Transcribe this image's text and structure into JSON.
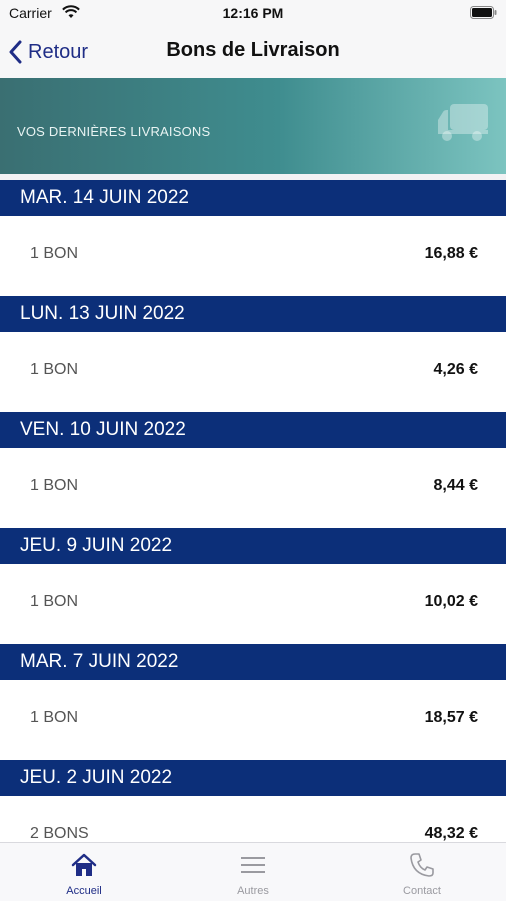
{
  "status_bar": {
    "carrier": "Carrier",
    "time": "12:16 PM"
  },
  "nav": {
    "back_label": "Retour",
    "title": "Bons de Livraison"
  },
  "banner": {
    "text": "VOS DERNIÈRES LIVRAISONS",
    "icon": "truck-icon"
  },
  "deliveries": [
    {
      "date": "MAR. 14 JUIN 2022",
      "count": "1 BON",
      "amount": "16,88 €"
    },
    {
      "date": "LUN. 13 JUIN 2022",
      "count": "1 BON",
      "amount": "4,26 €"
    },
    {
      "date": "VEN. 10 JUIN 2022",
      "count": "1 BON",
      "amount": "8,44 €"
    },
    {
      "date": "JEU. 9 JUIN 2022",
      "count": "1 BON",
      "amount": "10,02 €"
    },
    {
      "date": "MAR. 7 JUIN 2022",
      "count": "1 BON",
      "amount": "18,57 €"
    },
    {
      "date": "JEU. 2 JUIN 2022",
      "count": "2 BONS",
      "amount": "48,32 €"
    }
  ],
  "tabs": [
    {
      "label": "Accueil",
      "icon": "home-icon",
      "active": true
    },
    {
      "label": "Autres",
      "icon": "menu-icon",
      "active": false
    },
    {
      "label": "Contact",
      "icon": "phone-icon",
      "active": false
    }
  ],
  "colors": {
    "accent": "#1f2d86",
    "date_header": "#0c2f79",
    "inactive_tab": "#9a9aa0"
  }
}
